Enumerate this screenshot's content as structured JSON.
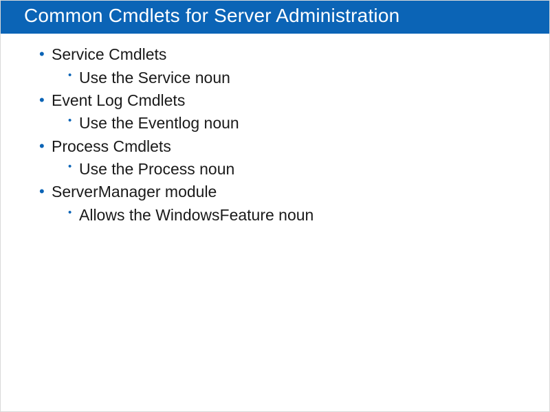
{
  "title": "Common Cmdlets for Server Administration",
  "bullets": [
    {
      "label": "Service Cmdlets",
      "sub": "Use the Service noun"
    },
    {
      "label": "Event Log Cmdlets",
      "sub": "Use the Eventlog noun"
    },
    {
      "label": "Process Cmdlets",
      "sub": "Use the Process noun"
    },
    {
      "label": "ServerManager module",
      "sub": "Allows the WindowsFeature noun"
    }
  ]
}
